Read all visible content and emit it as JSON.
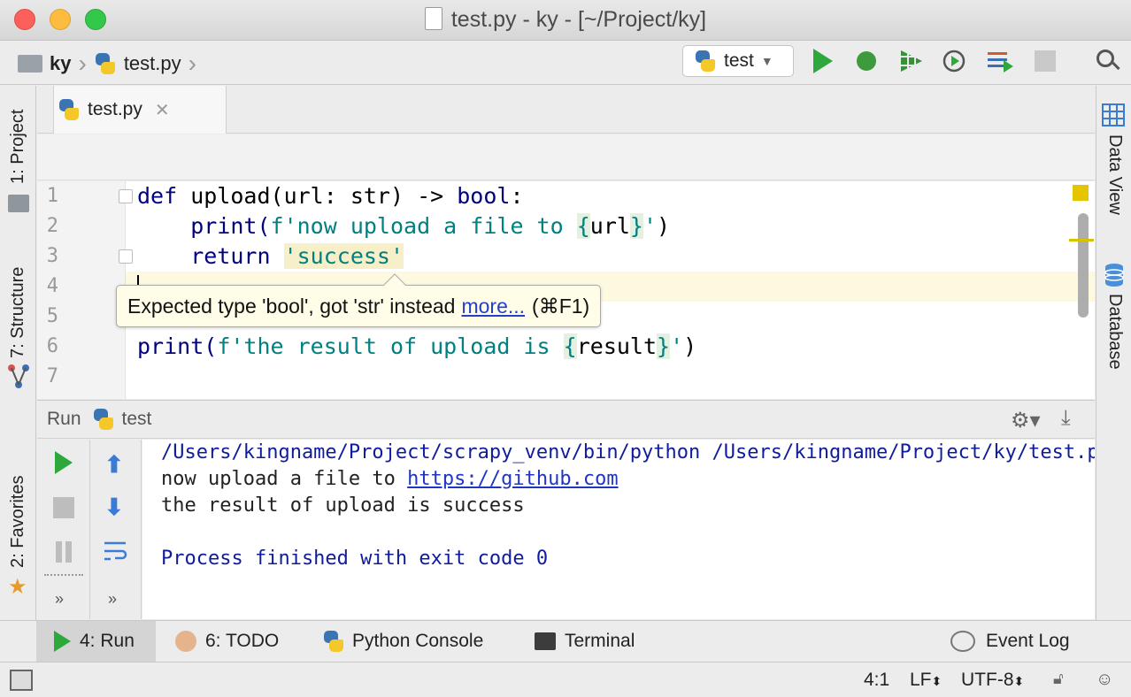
{
  "window": {
    "title": "test.py - ky - [~/Project/ky]"
  },
  "navbar": {
    "crumbs": [
      "ky",
      "test.py"
    ],
    "run_config": "test"
  },
  "left_tabs": {
    "project": "1: Project",
    "structure": "7: Structure",
    "favorites": "2: Favorites"
  },
  "right_tabs": {
    "data_view": "Data View",
    "database": "Database"
  },
  "editor": {
    "tab_label": "test.py",
    "line_numbers": [
      "1",
      "2",
      "3",
      "4",
      "5",
      "6",
      "7"
    ],
    "lines": {
      "l1_def": "def",
      "l1_rest": " upload(url: str) -> ",
      "l1_bool": "bool",
      "l1_colon": ":",
      "l2_print": "    print(",
      "l2_fstr": "f'now upload a file to ",
      "l2_open": "{",
      "l2_var": "url",
      "l2_close": "}",
      "l2_end_q": "'",
      "l2_paren": ")",
      "l3_return": "    return",
      "l3_space": " ",
      "l3_str": "'success'",
      "l6_print": "print(",
      "l6_fstr": "f'the result of upload is ",
      "l6_open": "{",
      "l6_var": "result",
      "l6_close": "}",
      "l6_end_q": "'",
      "l6_paren": ")"
    },
    "tooltip": {
      "message": "Expected type 'bool', got 'str' instead",
      "link": "more...",
      "shortcut": "(⌘F1)"
    }
  },
  "run_panel": {
    "label": "Run",
    "config": "test",
    "output": [
      {
        "text": "/Users/kingname/Project/scrapy_venv/bin/python /Users/kingname/Project/ky/test.py",
        "style": "blue"
      },
      {
        "text": "now upload a file to ",
        "style": "plain",
        "link": "https://github.com"
      },
      {
        "text": "the result of upload is success",
        "style": "plain"
      },
      {
        "text": "",
        "style": "plain"
      },
      {
        "text": "Process finished with exit code 0",
        "style": "blue"
      }
    ]
  },
  "toolwindows": {
    "run": "4: Run",
    "todo": "6: TODO",
    "python_console": "Python Console",
    "terminal": "Terminal",
    "event_log": "Event Log"
  },
  "statusbar": {
    "position": "4:1",
    "line_sep": "LF",
    "encoding": "UTF-8"
  },
  "colors": {
    "run_green": "#2ea83c",
    "keyword": "#000080",
    "string": "#008080",
    "warning": "#e6c400"
  }
}
